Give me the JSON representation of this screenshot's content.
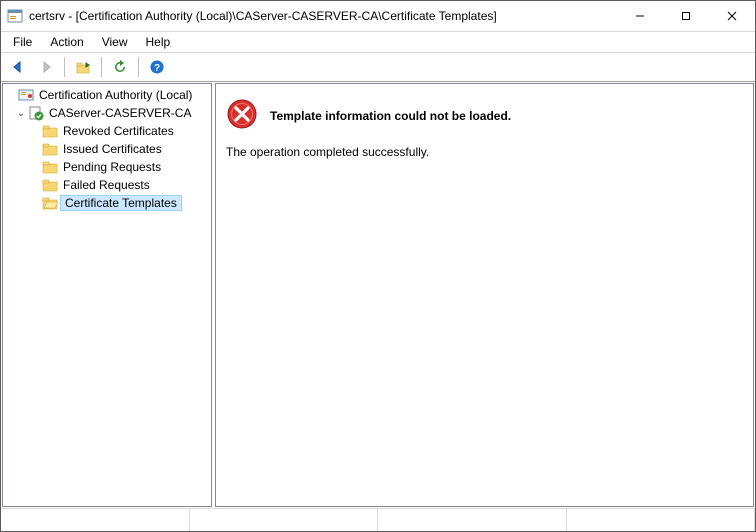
{
  "title": "certsrv - [Certification Authority (Local)\\CAServer-CASERVER-CA\\Certificate Templates]",
  "menu": {
    "file": "File",
    "action": "Action",
    "view": "View",
    "help": "Help"
  },
  "tree": {
    "root": "Certification Authority (Local)",
    "ca": "CAServer-CASERVER-CA",
    "items": {
      "revoked": "Revoked Certificates",
      "issued": "Issued Certificates",
      "pending": "Pending Requests",
      "failed": "Failed Requests",
      "templates": "Certificate Templates"
    }
  },
  "content": {
    "error_heading": "Template information could not be loaded.",
    "message": "The operation completed successfully."
  }
}
